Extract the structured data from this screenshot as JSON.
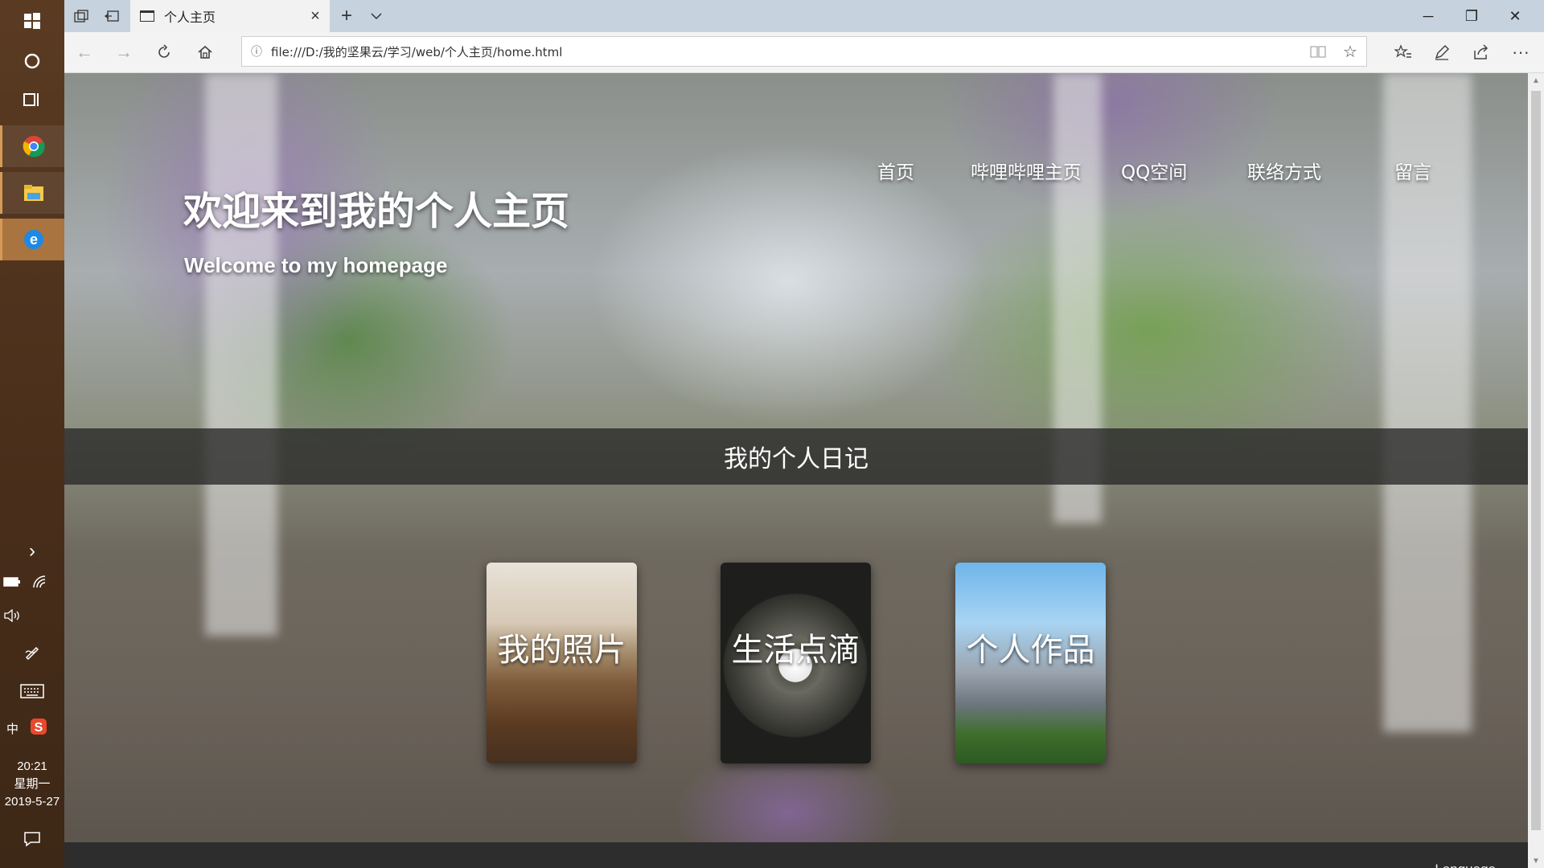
{
  "taskbar": {
    "icons": [
      "windows-start-icon",
      "cortana-circle-icon",
      "task-view-icon",
      "chrome-icon",
      "file-explorer-icon",
      "edge-icon"
    ],
    "tray": {
      "expand": "›",
      "ime": "中"
    },
    "clock": {
      "time": "20:21",
      "weekday": "星期一",
      "date": "2019-5-27"
    }
  },
  "browser": {
    "tab": {
      "title": "个人主页"
    },
    "address": {
      "url": "file:///D:/我的坚果云/学习/web/个人主页/home.html"
    },
    "window_controls": {
      "minimize": "─",
      "restore": "❐",
      "close": "✕"
    }
  },
  "page": {
    "title": "欢迎来到我的个人主页",
    "subtitle": "Welcome to my homepage",
    "nav": [
      "首页",
      "哔哩哔哩主页",
      "QQ空间",
      "联络方式",
      "留言"
    ],
    "diary_heading": "我的个人日记",
    "cards": [
      "我的照片",
      "生活点滴",
      "个人作品"
    ],
    "footer": {
      "language": "Language"
    }
  }
}
